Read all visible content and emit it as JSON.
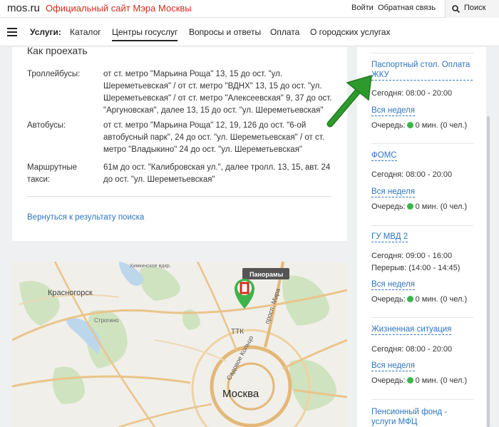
{
  "header": {
    "logo": "mos.ru",
    "site_title": "Официальный сайт Мэра Москвы",
    "links": [
      "Войти",
      "Обратная связь"
    ],
    "search_label": "Поиск"
  },
  "nav": {
    "label": "Услуги:",
    "items": [
      "Каталог",
      "Центры госуслуг",
      "Вопросы и ответы",
      "Оплата",
      "О городских услугах"
    ],
    "active": "Центры госуслуг"
  },
  "content": {
    "section_title": "Как проехать",
    "routes": [
      {
        "type": "Троллейбусы:",
        "text": "от ст. метро \"Марьина Роща\" 13, 15 до ост. \"ул. Шереметьевская\" / от ст. метро \"ВДНХ\" 13, 15 до ост. \"ул. Шереметьевская\" / от ст. метро \"Алексеевская\" 9, 37 до ост. \"Аргуновская\", далее 13, 15 до ост. \"ул. Шереметьевская\""
      },
      {
        "type": "Автобусы:",
        "text": "от ст. метро \"Марьина Роща\" 12, 19, 126 до ост. \"6-ой автобусный парк\", 24 до ост. \"ул. Шереметьевская\" / от ст. метро \"Владыкино\" 24 до ост. \"ул. Шереметьевская\""
      },
      {
        "type": "Маршрутные такси:",
        "text": "61м до ост. \"Калибровская ул.\", далее тролл. 13, 15, авт. 24 до ост. \"ул. Шереметьевская\""
      }
    ],
    "back_link": "Вернуться к результату поиска"
  },
  "map": {
    "panorama_label": "Панорамы",
    "labels": {
      "city": "Москва",
      "krasnogorsk": "Красногорск",
      "ttk": "ТТК",
      "sadovoe": "Садовое Кольцо",
      "prosp_mira": "просп. Мира",
      "strogino": "Строгино",
      "khimki": "Химкинское вдхр."
    }
  },
  "services": [
    {
      "name": "Паспортный стол. Оплата ЖКУ",
      "today": "Сегодня: 08:00 - 20:00",
      "week": "Вся неделя",
      "queue": "0 мин. (0 чел.)"
    },
    {
      "name": "ФОМС",
      "today": "Сегодня: 08:00 - 20:00",
      "week": "Вся неделя",
      "queue": "0 мин. (0 чел.)"
    },
    {
      "name": "ГУ МВД 2",
      "today": "Сегодня: 09:00 - 16:00",
      "break": "Перерыв: (14:00 - 14:45)",
      "week": "Вся неделя",
      "queue": "0 мин. (0 чел.)"
    },
    {
      "name": "Жизненная ситуация",
      "today": "Сегодня: 08:00 - 20:00",
      "week": "Вся неделя",
      "queue": "0 мин. (0 чел.)"
    },
    {
      "name": "Пенсионный фонд - услуги МФЦ"
    }
  ],
  "queue_label": "Очередь:",
  "colors": {
    "accent": "#d52b1e",
    "link": "#2f75c0",
    "status_green": "#3cb44b",
    "arrow": "#2e8b2e"
  }
}
